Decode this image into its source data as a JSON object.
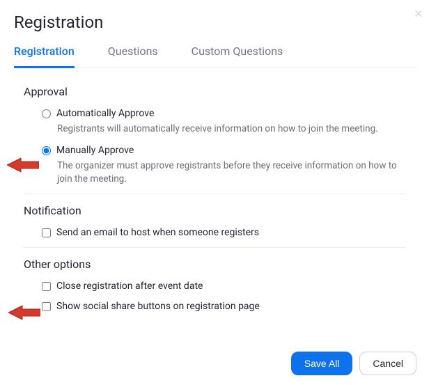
{
  "dialog": {
    "title": "Registration"
  },
  "tabs": [
    {
      "label": "Registration",
      "active": true
    },
    {
      "label": "Questions",
      "active": false
    },
    {
      "label": "Custom Questions",
      "active": false
    }
  ],
  "sections": {
    "approval": {
      "title": "Approval",
      "options": [
        {
          "label": "Automatically Approve",
          "description": "Registrants will automatically receive information on how to join the meeting.",
          "checked": false
        },
        {
          "label": "Manually Approve",
          "description": "The organizer must approve registrants before they receive information on how to join the meeting.",
          "checked": true
        }
      ]
    },
    "notification": {
      "title": "Notification",
      "options": [
        {
          "label": "Send an email to host when someone registers",
          "checked": false
        }
      ]
    },
    "other": {
      "title": "Other options",
      "options": [
        {
          "label": "Close registration after event date",
          "checked": false
        },
        {
          "label": "Show social share buttons on registration page",
          "checked": false
        }
      ]
    }
  },
  "footer": {
    "save": "Save All",
    "cancel": "Cancel"
  }
}
